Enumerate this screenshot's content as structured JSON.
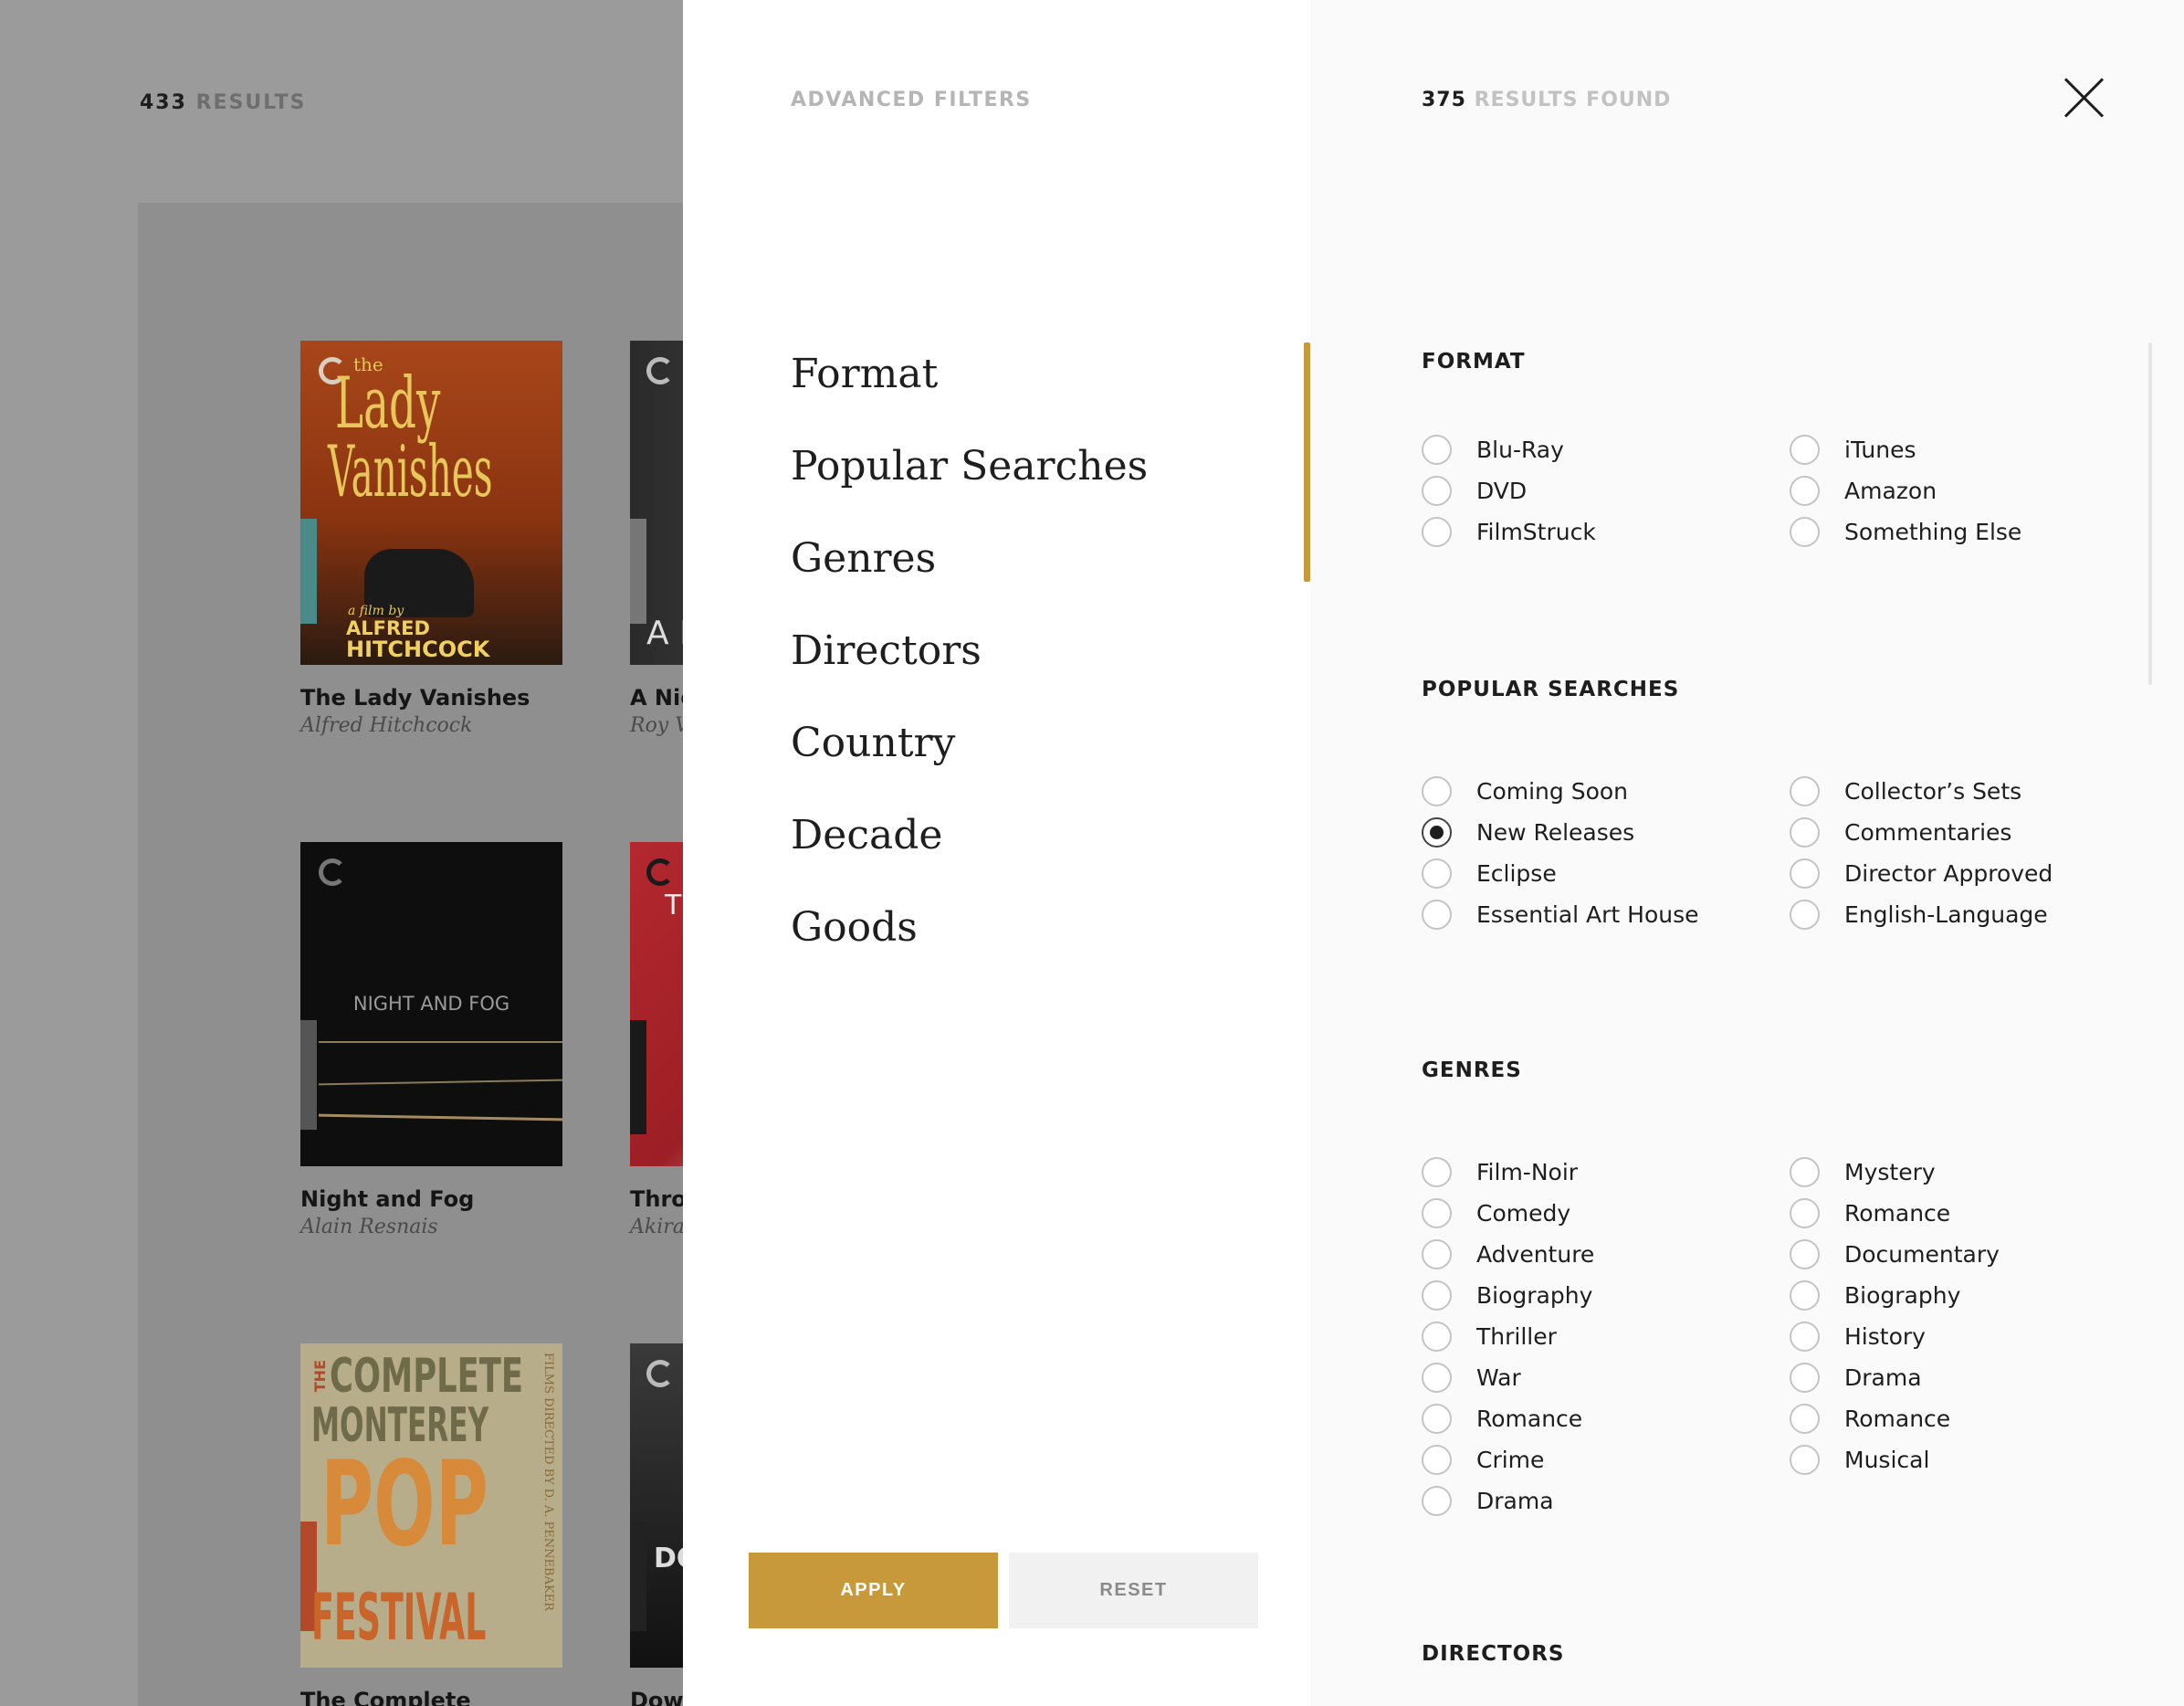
{
  "background": {
    "results_count": "433",
    "results_label": "RESULTS",
    "cards": [
      {
        "title": "The Lady Vanishes",
        "director": "Alfred Hitchcock",
        "cover_text_1": "the",
        "cover_text_2": "Lady",
        "cover_text_3": "Vanishes",
        "cover_text_4": "a film by",
        "cover_text_5": "ALFRED",
        "cover_text_6": "HITCHCOCK"
      },
      {
        "title": "A Nig",
        "director": "Roy V",
        "cover_text_1": "A N"
      },
      {
        "title": "Night and Fog",
        "director": "Alain Resnais",
        "cover_text_1": "NIGHT AND FOG"
      },
      {
        "title": "Thro",
        "director": "Akira",
        "cover_text_1": "T"
      },
      {
        "title": "The Complete",
        "director": "",
        "cover_text_1": "THE",
        "cover_text_2": "COMPLETE",
        "cover_text_3": "MONTEREY",
        "cover_text_4": "POP",
        "cover_text_5": "FESTIVAL",
        "cover_text_6": "FILMS DIRECTED BY D. A. PENNEBAKER"
      },
      {
        "title": "Dow",
        "director": "",
        "cover_text_1": "DO"
      }
    ]
  },
  "menu": {
    "title": "ADVANCED FILTERS",
    "items": [
      "Format",
      "Popular Searches",
      "Genres",
      "Directors",
      "Country",
      "Decade",
      "Goods"
    ],
    "apply_label": "APPLY",
    "reset_label": "RESET",
    "accent_color": "#c8993a"
  },
  "options": {
    "results_count": "375",
    "results_label": "RESULTS FOUND",
    "close_icon": "close-icon",
    "sections": {
      "format": {
        "title": "FORMAT",
        "left": [
          {
            "label": "Blu-Ray",
            "selected": false
          },
          {
            "label": "DVD",
            "selected": false
          },
          {
            "label": "FilmStruck",
            "selected": false
          }
        ],
        "right": [
          {
            "label": "iTunes",
            "selected": false
          },
          {
            "label": "Amazon",
            "selected": false
          },
          {
            "label": "Something Else",
            "selected": false
          }
        ]
      },
      "popular": {
        "title": "POPULAR SEARCHES",
        "left": [
          {
            "label": "Coming Soon",
            "selected": false
          },
          {
            "label": "New Releases",
            "selected": true
          },
          {
            "label": "Eclipse",
            "selected": false
          },
          {
            "label": "Essential Art House",
            "selected": false
          }
        ],
        "right": [
          {
            "label": "Collector’s Sets",
            "selected": false
          },
          {
            "label": "Commentaries",
            "selected": false
          },
          {
            "label": "Director Approved",
            "selected": false
          },
          {
            "label": "English-Language",
            "selected": false
          }
        ]
      },
      "genres": {
        "title": "GENRES",
        "left": [
          {
            "label": "Film-Noir",
            "selected": false
          },
          {
            "label": "Comedy",
            "selected": false
          },
          {
            "label": "Adventure",
            "selected": false
          },
          {
            "label": "Biography",
            "selected": false
          },
          {
            "label": "Thriller",
            "selected": false
          },
          {
            "label": "War",
            "selected": false
          },
          {
            "label": "Romance",
            "selected": false
          },
          {
            "label": "Crime",
            "selected": false
          },
          {
            "label": "Drama",
            "selected": false
          }
        ],
        "right": [
          {
            "label": "Mystery",
            "selected": false
          },
          {
            "label": "Romance",
            "selected": false
          },
          {
            "label": "Documentary",
            "selected": false
          },
          {
            "label": "Biography",
            "selected": false
          },
          {
            "label": "History",
            "selected": false
          },
          {
            "label": "Drama",
            "selected": false
          },
          {
            "label": "Romance",
            "selected": false
          },
          {
            "label": "Musical",
            "selected": false
          }
        ]
      },
      "directors": {
        "title": "DIRECTORS"
      }
    }
  }
}
